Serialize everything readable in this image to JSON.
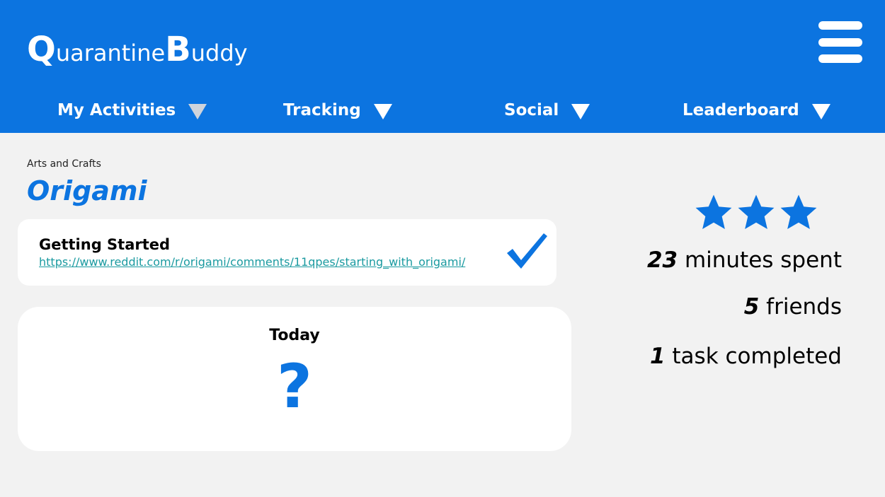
{
  "app": {
    "logo_q": "Q",
    "logo_mid": "uarantine",
    "logo_b": "B",
    "logo_end": "uddy"
  },
  "nav": [
    {
      "label": "My Activities",
      "icon": "triangle-down-icon",
      "icon_color": "#cfd4dc"
    },
    {
      "label": "Tracking",
      "icon": "triangle-down-icon",
      "icon_color": "#ffffff"
    },
    {
      "label": "Social",
      "icon": "triangle-down-icon",
      "icon_color": "#ffffff"
    },
    {
      "label": "Leaderboard",
      "icon": "triangle-down-icon",
      "icon_color": "#ffffff"
    }
  ],
  "activity": {
    "category": "Arts and Crafts",
    "title": "Origami"
  },
  "resource_card": {
    "heading": "Getting Started",
    "link": "https://www.reddit.com/r/origami/comments/11qpes/starting_with_origami/",
    "status_icon": "checkmark-icon"
  },
  "today_card": {
    "heading": "Today",
    "value": "?"
  },
  "rating": {
    "stars": 3,
    "max": 3,
    "icon": "star-icon"
  },
  "stats": {
    "minutes_value": "23",
    "minutes_label": " minutes spent",
    "friends_value": "5",
    "friends_label": " friends",
    "tasks_value": "1",
    "tasks_label": " task completed"
  },
  "colors": {
    "brand": "#0c74e0",
    "background": "#f2f2f2",
    "link": "#1a9aa0"
  }
}
